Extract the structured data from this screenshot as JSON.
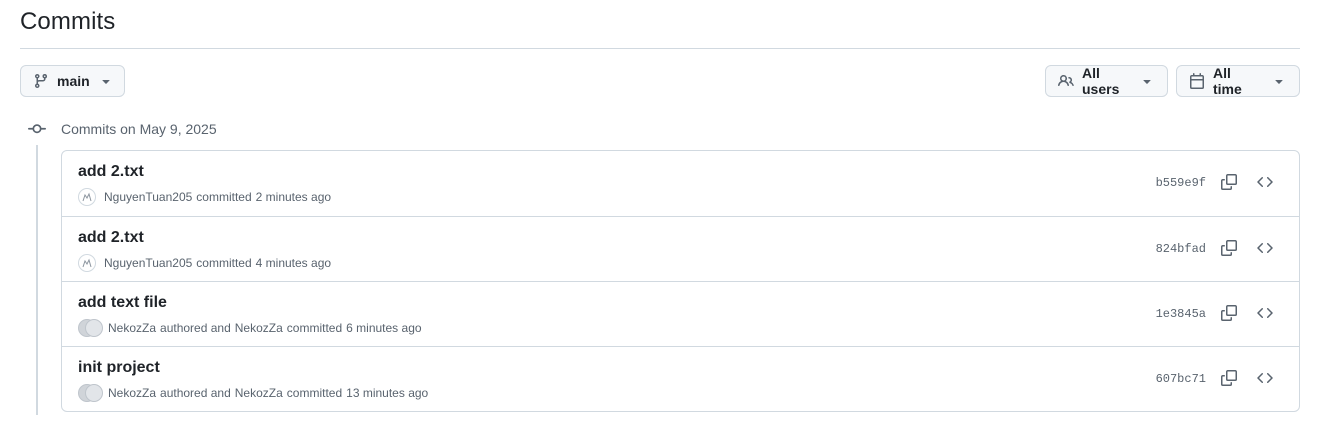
{
  "page": {
    "title": "Commits"
  },
  "toolbar": {
    "branch_label": "main",
    "users_label": "All users",
    "time_label": "All time"
  },
  "group": {
    "heading": "Commits on May 9, 2025"
  },
  "commits": [
    {
      "title": "add 2.txt",
      "author": "NguyenTuan205",
      "action": "committed",
      "time": "2 minutes ago",
      "sha": "b559e9f",
      "avatar": "single"
    },
    {
      "title": "add 2.txt",
      "author": "NguyenTuan205",
      "action": "committed",
      "time": "4 minutes ago",
      "sha": "824bfad",
      "avatar": "single"
    },
    {
      "title": "add text file",
      "author": "NekozZa",
      "joiner": "authored and",
      "committer": "NekozZa",
      "action": "committed",
      "time": "6 minutes ago",
      "sha": "1e3845a",
      "avatar": "pair"
    },
    {
      "title": "init project",
      "author": "NekozZa",
      "joiner": "authored and",
      "committer": "NekozZa",
      "action": "committed",
      "time": "13 minutes ago",
      "sha": "607bc71",
      "avatar": "pair"
    }
  ],
  "icons": {
    "branch": "git-branch-icon",
    "caret": "triangle-down-icon",
    "people": "people-icon",
    "calendar": "calendar-icon",
    "commit": "git-commit-icon",
    "copy": "copy-icon",
    "code": "code-icon"
  },
  "colors": {
    "text": "#1f2328",
    "muted": "#59636e",
    "border": "#d1d9e0",
    "button_bg": "#f6f8fa"
  }
}
